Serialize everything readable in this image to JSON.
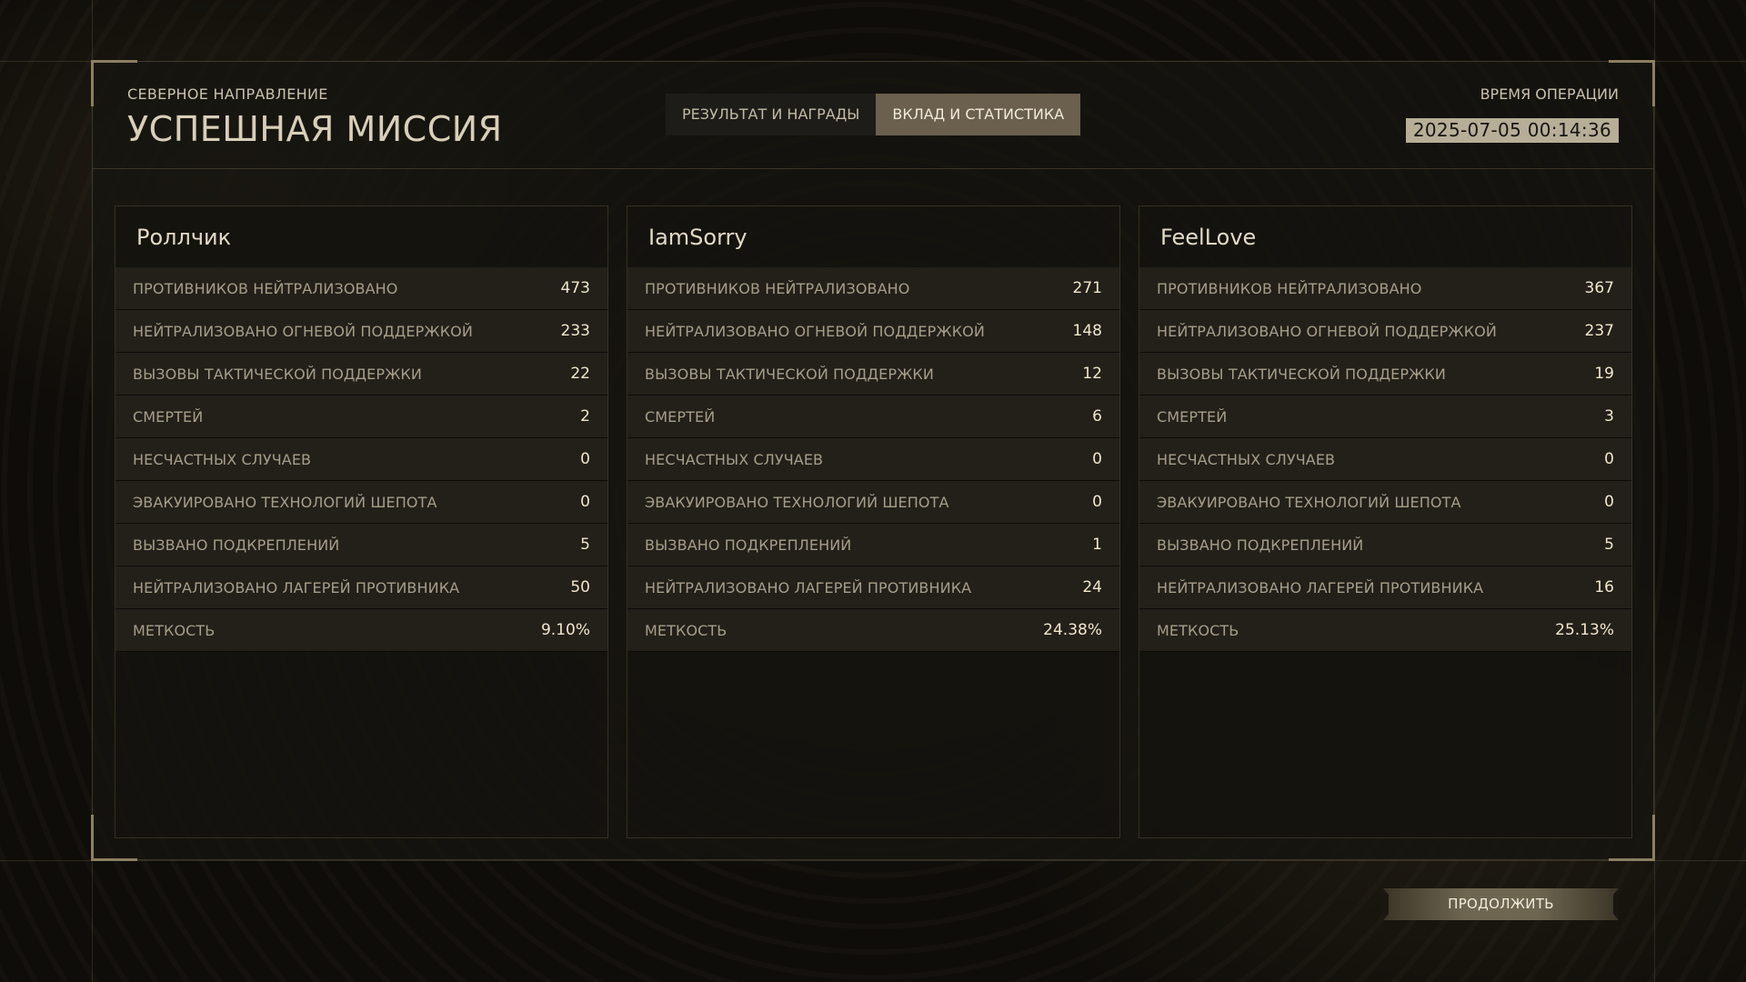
{
  "header": {
    "subtitle": "СЕВЕРНОЕ НАПРАВЛЕНИЕ",
    "title": "УСПЕШНАЯ МИССИЯ",
    "tabs": [
      {
        "label": "РЕЗУЛЬТАТ И НАГРАДЫ",
        "active": false
      },
      {
        "label": "ВКЛАД И СТАТИСТИКА",
        "active": true
      }
    ],
    "operation_time_label": "ВРЕМЯ ОПЕРАЦИИ",
    "operation_time_value": "2025-07-05 00:14:36"
  },
  "players": [
    {
      "name": "Роллчик",
      "stats": [
        {
          "label": "ПРОТИВНИКОВ НЕЙТРАЛИЗОВАНО",
          "value": "473"
        },
        {
          "label": "НЕЙТРАЛИЗОВАНО ОГНЕВОЙ ПОДДЕРЖКОЙ",
          "value": "233"
        },
        {
          "label": "ВЫЗОВЫ ТАКТИЧЕСКОЙ ПОДДЕРЖКИ",
          "value": "22"
        },
        {
          "label": "СМЕРТЕЙ",
          "value": "2"
        },
        {
          "label": "НЕСЧАСТНЫХ СЛУЧАЕВ",
          "value": "0"
        },
        {
          "label": "ЭВАКУИРОВАНО ТЕХНОЛОГИЙ ШЕПОТА",
          "value": "0"
        },
        {
          "label": "ВЫЗВАНО ПОДКРЕПЛЕНИЙ",
          "value": "5"
        },
        {
          "label": "НЕЙТРАЛИЗОВАНО ЛАГЕРЕЙ ПРОТИВНИКА",
          "value": "50"
        },
        {
          "label": "МЕТКОСТЬ",
          "value": "9.10%"
        }
      ]
    },
    {
      "name": "IamSorry",
      "stats": [
        {
          "label": "ПРОТИВНИКОВ НЕЙТРАЛИЗОВАНО",
          "value": "271"
        },
        {
          "label": "НЕЙТРАЛИЗОВАНО ОГНЕВОЙ ПОДДЕРЖКОЙ",
          "value": "148"
        },
        {
          "label": "ВЫЗОВЫ ТАКТИЧЕСКОЙ ПОДДЕРЖКИ",
          "value": "12"
        },
        {
          "label": "СМЕРТЕЙ",
          "value": "6"
        },
        {
          "label": "НЕСЧАСТНЫХ СЛУЧАЕВ",
          "value": "0"
        },
        {
          "label": "ЭВАКУИРОВАНО ТЕХНОЛОГИЙ ШЕПОТА",
          "value": "0"
        },
        {
          "label": "ВЫЗВАНО ПОДКРЕПЛЕНИЙ",
          "value": "1"
        },
        {
          "label": "НЕЙТРАЛИЗОВАНО ЛАГЕРЕЙ ПРОТИВНИКА",
          "value": "24"
        },
        {
          "label": "МЕТКОСТЬ",
          "value": "24.38%"
        }
      ]
    },
    {
      "name": "FeelLove",
      "stats": [
        {
          "label": "ПРОТИВНИКОВ НЕЙТРАЛИЗОВАНО",
          "value": "367"
        },
        {
          "label": "НЕЙТРАЛИЗОВАНО ОГНЕВОЙ ПОДДЕРЖКОЙ",
          "value": "237"
        },
        {
          "label": "ВЫЗОВЫ ТАКТИЧЕСКОЙ ПОДДЕРЖКИ",
          "value": "19"
        },
        {
          "label": "СМЕРТЕЙ",
          "value": "3"
        },
        {
          "label": "НЕСЧАСТНЫХ СЛУЧАЕВ",
          "value": "0"
        },
        {
          "label": "ЭВАКУИРОВАНО ТЕХНОЛОГИЙ ШЕПОТА",
          "value": "0"
        },
        {
          "label": "ВЫЗВАНО ПОДКРЕПЛЕНИЙ",
          "value": "5"
        },
        {
          "label": "НЕЙТРАЛИЗОВАНО ЛАГЕРЕЙ ПРОТИВНИКА",
          "value": "16"
        },
        {
          "label": "МЕТКОСТЬ",
          "value": "25.13%"
        }
      ]
    }
  ],
  "footer": {
    "continue_label": "ПРОДОЛЖИТЬ"
  },
  "colors": {
    "accent": "#6a604d",
    "stat_value": "#f0e6cc",
    "stat_label": "#a69e8a",
    "time_badge": "#b7ae98"
  }
}
